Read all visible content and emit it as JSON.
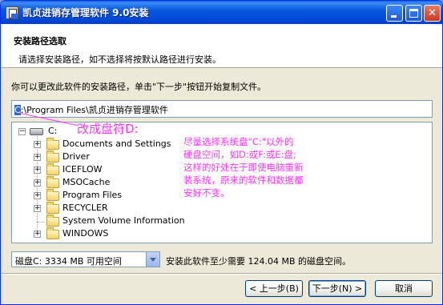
{
  "window": {
    "title": "凯贞进销存管理软件 9.0安装"
  },
  "header": {
    "title": "安装路径选取",
    "subtitle": "请选择安装路径，如不选择将按默认路径进行安装。"
  },
  "instruction": "你可以更改此软件的安装路径，单击\"下一步\"按钮开始复制文件。",
  "path_input": {
    "selected": "C",
    "rest": ":\\Program Files\\凯贞进销存管理软件"
  },
  "tree": {
    "root": "C:",
    "items": [
      {
        "label": "Documents and Settings",
        "expandable": true
      },
      {
        "label": "Driver",
        "expandable": true
      },
      {
        "label": "ICEFLOW",
        "expandable": true
      },
      {
        "label": "MSOCache",
        "expandable": true
      },
      {
        "label": "Program Files",
        "expandable": true
      },
      {
        "label": "RECYCLER",
        "expandable": true
      },
      {
        "label": "System Volume Information",
        "expandable": false
      },
      {
        "label": "WINDOWS",
        "expandable": true
      }
    ],
    "expander_plus": "+",
    "expander_minus": "−"
  },
  "annotations": {
    "change_drive": "改成盘符D:",
    "note_lines": [
      "尽量选择系统盘\"C:\"以外的",
      "硬盘空间，如D:或F:或E:盘;",
      "这样的好处在于即使电脑重新",
      "装系统，原来的软件和数据都",
      "安好不变。"
    ]
  },
  "drive_select": {
    "value": "磁盘C:  3334 MB 可用空间"
  },
  "space_required": "安装此软件至少需要 124.04 MB 的磁盘空间。",
  "buttons": {
    "back": "< 上一步(B)",
    "next": "下一步(N) >",
    "cancel": "取消"
  },
  "colors": {
    "annotation": "#ff33ff",
    "title_bar": "#0054e3",
    "selection": "#316ac5"
  }
}
